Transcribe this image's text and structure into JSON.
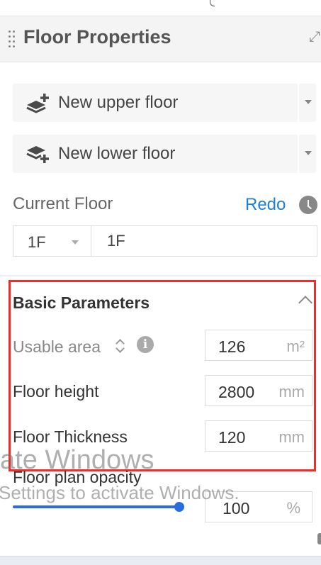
{
  "panel": {
    "title": "Floor Properties"
  },
  "actions": {
    "new_upper": "New upper floor",
    "new_lower": "New lower floor"
  },
  "current_floor": {
    "label": "Current Floor",
    "redo": "Redo",
    "selected": "1F",
    "name_value": "1F"
  },
  "basic_parameters": {
    "title": "Basic Parameters",
    "usable_area": {
      "label": "Usable area",
      "value": "126",
      "unit": "m²"
    },
    "floor_height": {
      "label": "Floor height",
      "value": "2800",
      "unit": "mm"
    },
    "floor_thickness": {
      "label": "Floor Thickness",
      "value": "120",
      "unit": "mm"
    }
  },
  "opacity": {
    "label": "Floor plan opacity",
    "value": "100",
    "unit": "%",
    "fraction": 1.0
  },
  "watermark": {
    "line1": "ate Windows",
    "line2": "Settings to activate Windows."
  },
  "colors": {
    "accent": "#2a6dde",
    "link": "#1e7fd8",
    "highlight": "#f52a2a"
  }
}
